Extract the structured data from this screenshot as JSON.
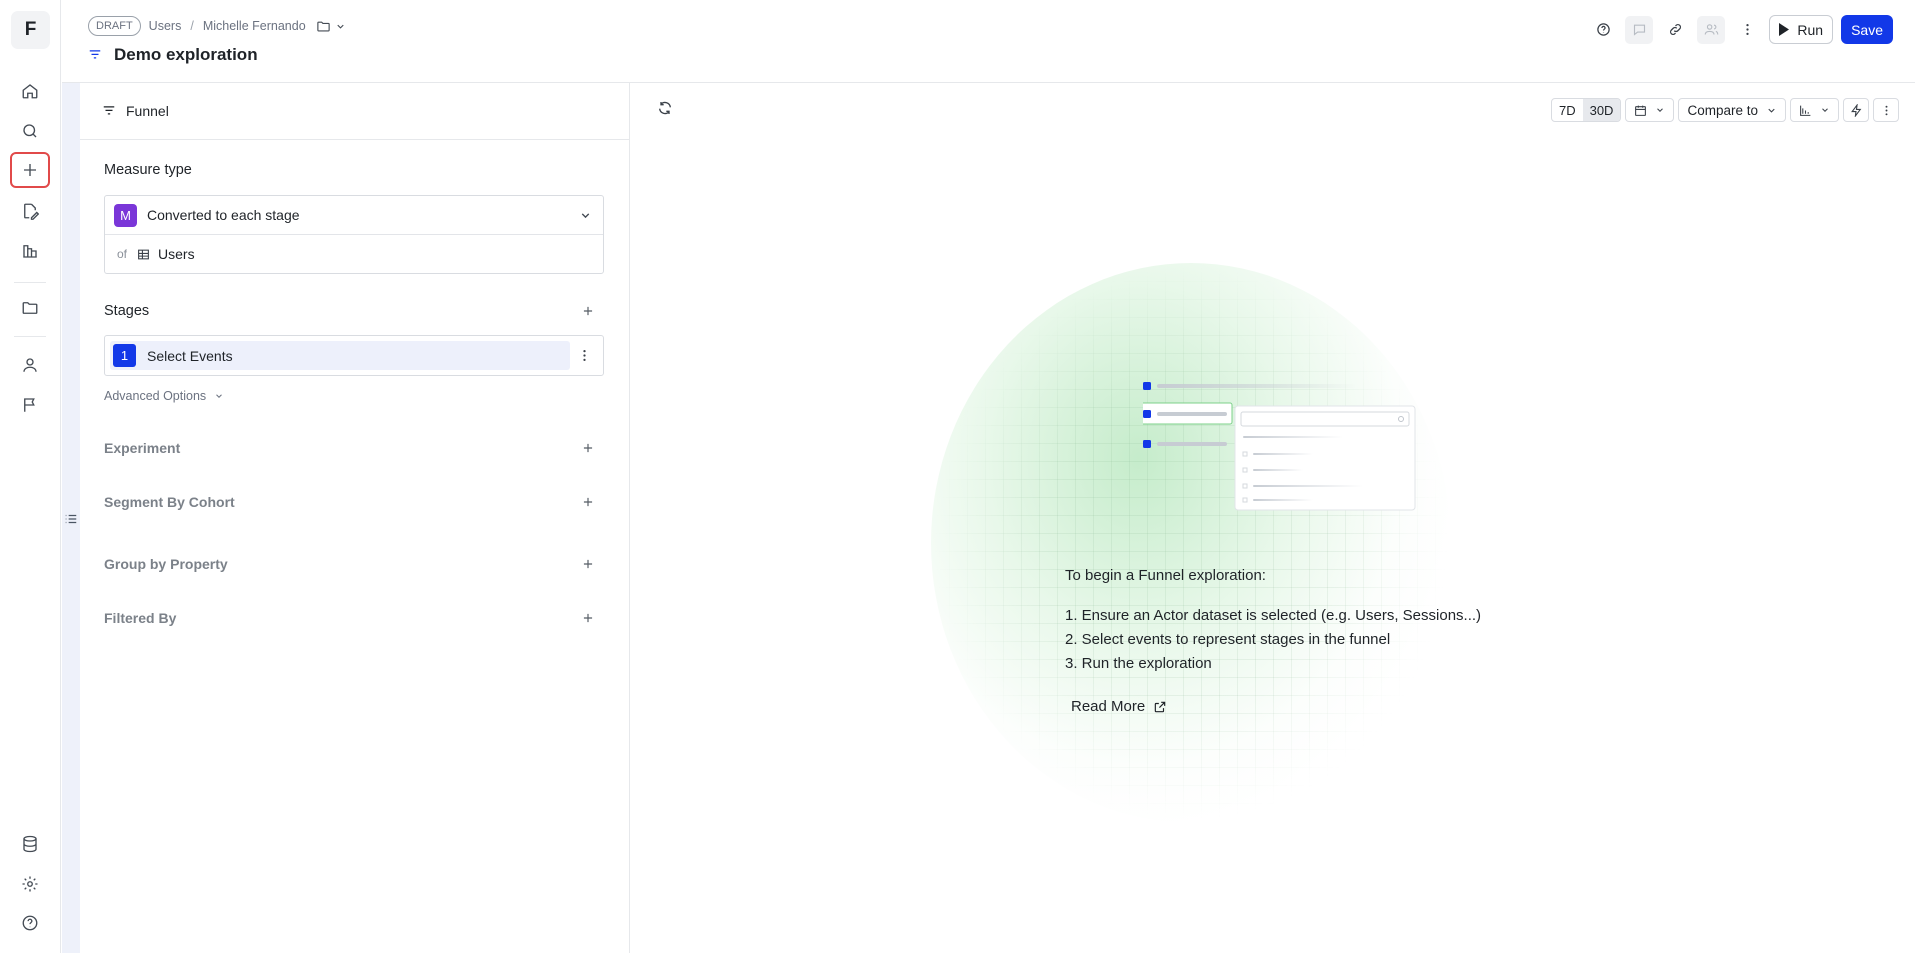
{
  "app": {
    "logo_letter": "F"
  },
  "breadcrumb": {
    "status": "DRAFT",
    "items": [
      "Users",
      "Michelle Fernando"
    ]
  },
  "page_title": "Demo exploration",
  "header_actions": {
    "run_label": "Run",
    "save_label": "Save"
  },
  "panel": {
    "tab_label": "Funnel",
    "measure": {
      "label": "Measure type",
      "badge": "M",
      "selected": "Converted to each stage",
      "of_label": "of",
      "dataset": "Users"
    },
    "stages": {
      "label": "Stages",
      "items": [
        {
          "number": "1",
          "label": "Select Events"
        }
      ],
      "advanced_label": "Advanced Options"
    },
    "sections": [
      {
        "label": "Experiment"
      },
      {
        "label": "Segment By Cohort"
      },
      {
        "label": "Group by Property"
      },
      {
        "label": "Filtered By"
      }
    ]
  },
  "toolbar": {
    "ranges": [
      "7D",
      "30D"
    ],
    "selected_range": "30D",
    "compare_label": "Compare to"
  },
  "empty_state": {
    "title": "To begin a Funnel exploration:",
    "steps": [
      "1. Ensure an Actor dataset is selected (e.g. Users, Sessions...)",
      "2. Select events to represent stages in the funnel",
      "3. Run the exploration"
    ],
    "read_more": "Read More"
  },
  "colors": {
    "primary": "#1238e8",
    "measure_badge": "#7a36d8",
    "active_outline": "#e14a4a"
  },
  "icons": {
    "rail": [
      "home-icon",
      "search-icon",
      "plus-icon",
      "edit-doc-icon",
      "charts-icon",
      "folder-icon",
      "user-icon",
      "flag-icon"
    ],
    "rail_bottom": [
      "database-icon",
      "gear-icon",
      "help-icon"
    ]
  }
}
